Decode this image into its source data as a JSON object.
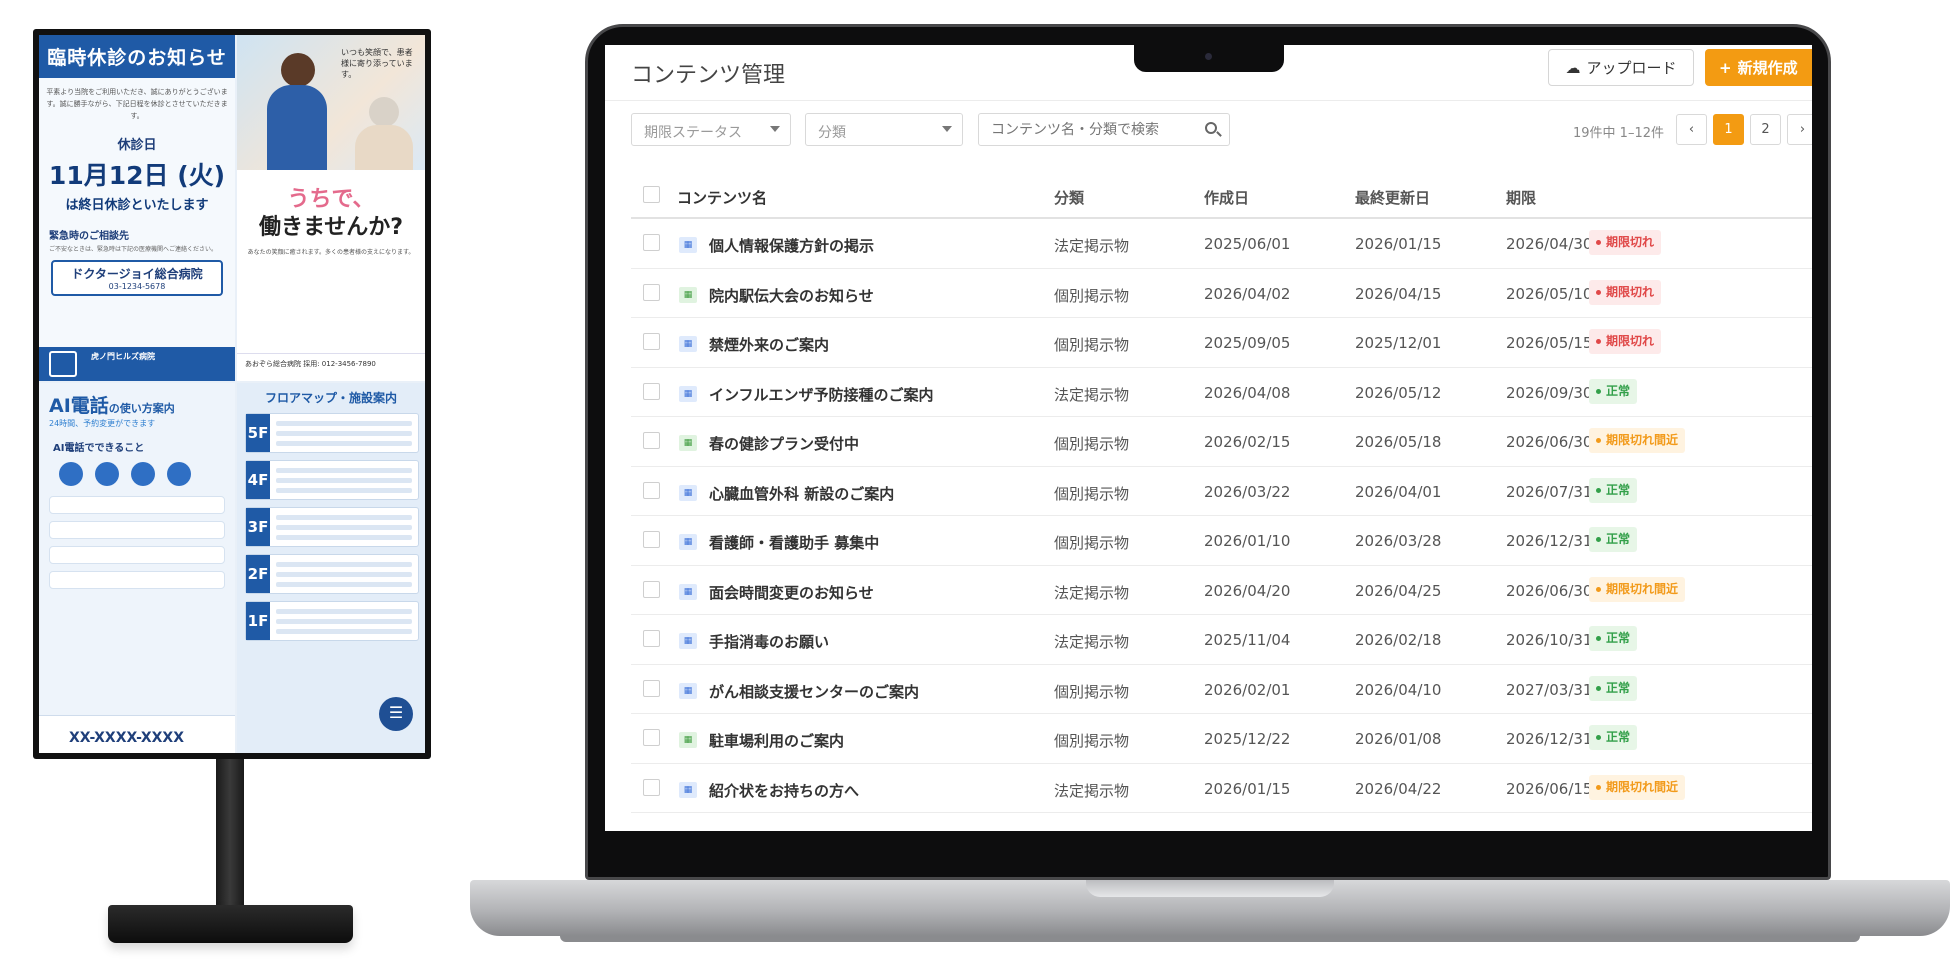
{
  "signage": {
    "panel1": {
      "title": "臨時休診のお知らせ",
      "body": "平素より当院をご利用いただき、誠にありがとうございます。誠に勝手ながら、下記日程を休診とさせていただきます。",
      "day_label": "休診日",
      "date": "11月12日 (火)",
      "date_sub": "は終日休診といたします",
      "emergency_title": "緊急時のご相談先",
      "emergency_text": "ご不安なときは、緊急時は下記の医療機関へご連絡ください。",
      "hospital_name": "ドクタージョイ総合病院",
      "hospital_tel": "03-1234-5678",
      "footer_name": "虎ノ門ヒルズ病院"
    },
    "panel2": {
      "quote": "いつも笑顔で、患者様に寄り添っています。",
      "title_line1": "うちで、",
      "title_line2": "働きませんか?",
      "small": "あなたの笑顔に癒されます。多くの患者様の支えになります。",
      "footer": "あおぞら総合病院 採用: 012-3456-7890"
    },
    "panel3": {
      "title": "AI電話",
      "title_suffix": "の使い方案内",
      "sub": "24時間、予約変更ができます",
      "can_do": "AI電話でできること",
      "tel": "XX-XXXX-XXXX"
    },
    "panel4": {
      "title": "フロアマップ・施設案内",
      "floors": [
        "5F",
        "4F",
        "3F",
        "2F",
        "1F"
      ]
    }
  },
  "app": {
    "title": "コンテンツ管理",
    "upload_button": "アップロード",
    "new_button": "新規作成",
    "filters": {
      "status_placeholder": "期限ステータス",
      "category_placeholder": "分類",
      "search_placeholder": "コンテンツ名・分類で検索"
    },
    "pagination": {
      "count_text": "19件中 1–12件",
      "pages": [
        "1",
        "2"
      ],
      "active_page": "1"
    },
    "table": {
      "columns": [
        "コンテンツ名",
        "分類",
        "作成日",
        "最終更新日",
        "期限"
      ],
      "rows": [
        {
          "name": "個人情報保護方針の掲示",
          "icon": "blue",
          "category": "法定掲示物",
          "created": "2025/06/01",
          "updated": "2026/01/15",
          "expiry": "2026/04/30",
          "status": "期限切れ",
          "status_type": "expired"
        },
        {
          "name": "院内駅伝大会のお知らせ",
          "icon": "green",
          "category": "個別掲示物",
          "created": "2026/04/02",
          "updated": "2026/04/15",
          "expiry": "2026/05/10",
          "status": "期限切れ",
          "status_type": "expired"
        },
        {
          "name": "禁煙外来のご案内",
          "icon": "blue",
          "category": "個別掲示物",
          "created": "2025/09/05",
          "updated": "2025/12/01",
          "expiry": "2026/05/15",
          "status": "期限切れ",
          "status_type": "expired"
        },
        {
          "name": "インフルエンザ予防接種のご案内",
          "icon": "blue",
          "category": "法定掲示物",
          "created": "2026/04/08",
          "updated": "2026/05/12",
          "expiry": "2026/09/30",
          "status": "正常",
          "status_type": "ok"
        },
        {
          "name": "春の健診プラン受付中",
          "icon": "green",
          "category": "個別掲示物",
          "created": "2026/02/15",
          "updated": "2026/05/18",
          "expiry": "2026/06/30",
          "status": "期限切れ間近",
          "status_type": "soon"
        },
        {
          "name": "心臓血管外科 新設のご案内",
          "icon": "blue",
          "category": "個別掲示物",
          "created": "2026/03/22",
          "updated": "2026/04/01",
          "expiry": "2026/07/31",
          "status": "正常",
          "status_type": "ok"
        },
        {
          "name": "看護師・看護助手 募集中",
          "icon": "blue",
          "category": "個別掲示物",
          "created": "2026/01/10",
          "updated": "2026/03/28",
          "expiry": "2026/12/31",
          "status": "正常",
          "status_type": "ok"
        },
        {
          "name": "面会時間変更のお知らせ",
          "icon": "blue",
          "category": "法定掲示物",
          "created": "2026/04/20",
          "updated": "2026/04/25",
          "expiry": "2026/06/30",
          "status": "期限切れ間近",
          "status_type": "soon"
        },
        {
          "name": "手指消毒のお願い",
          "icon": "blue",
          "category": "法定掲示物",
          "created": "2025/11/04",
          "updated": "2026/02/18",
          "expiry": "2026/10/31",
          "status": "正常",
          "status_type": "ok"
        },
        {
          "name": "がん相談支援センターのご案内",
          "icon": "blue",
          "category": "個別掲示物",
          "created": "2026/02/01",
          "updated": "2026/04/10",
          "expiry": "2027/03/31",
          "status": "正常",
          "status_type": "ok"
        },
        {
          "name": "駐車場利用のご案内",
          "icon": "green",
          "category": "個別掲示物",
          "created": "2025/12/22",
          "updated": "2026/01/08",
          "expiry": "2026/12/31",
          "status": "正常",
          "status_type": "ok"
        },
        {
          "name": "紹介状をお持ちの方へ",
          "icon": "blue",
          "category": "法定掲示物",
          "created": "2026/01/15",
          "updated": "2026/04/22",
          "expiry": "2026/06/15",
          "status": "期限切れ間近",
          "status_type": "soon"
        }
      ]
    },
    "colors": {
      "accent": "#f39b12",
      "expired": "#e04848",
      "ok": "#33a04a",
      "soon": "#f29a1a"
    }
  }
}
